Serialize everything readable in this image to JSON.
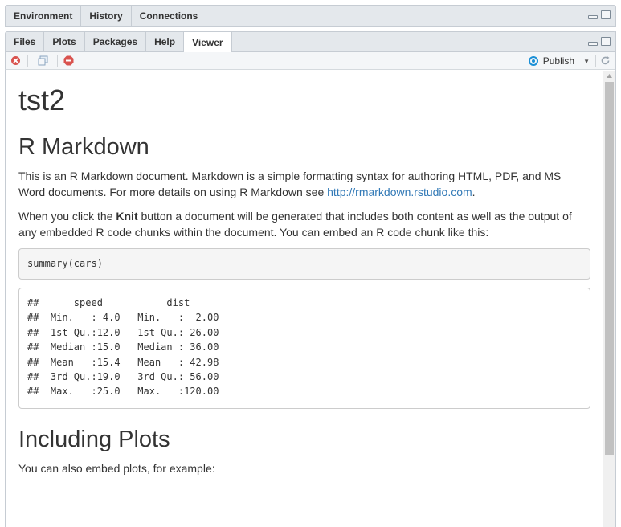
{
  "top_tabs": [
    {
      "label": "Environment"
    },
    {
      "label": "History"
    },
    {
      "label": "Connections"
    }
  ],
  "bottom_tabs": [
    {
      "label": "Files"
    },
    {
      "label": "Plots"
    },
    {
      "label": "Packages"
    },
    {
      "label": "Help"
    },
    {
      "label": "Viewer",
      "active": true
    }
  ],
  "toolbar": {
    "publish_label": "Publish",
    "icons": [
      "remove-viewer-icon",
      "show-in-new-window-icon",
      "stop-icon",
      "publish-icon",
      "refresh-icon"
    ]
  },
  "document": {
    "title": "tst2",
    "section1_heading": "R Markdown",
    "para1_text": "This is an R Markdown document. Markdown is a simple formatting syntax for authoring HTML, PDF, and MS Word documents. For more details on using R Markdown see ",
    "para1_link": "http://rmarkdown.rstudio.com",
    "para1_end": ".",
    "para2_before": "When you click the ",
    "para2_bold": "Knit",
    "para2_after": " button a document will be generated that includes both content as well as the output of any embedded R code chunks within the document. You can embed an R code chunk like this:",
    "code_chunk": "summary(cars)",
    "output_lines": [
      "##      speed           dist       ",
      "##  Min.   : 4.0   Min.   :  2.00  ",
      "##  1st Qu.:12.0   1st Qu.: 26.00  ",
      "##  Median :15.0   Median : 36.00  ",
      "##  Mean   :15.4   Mean   : 42.98  ",
      "##  3rd Qu.:19.0   3rd Qu.: 56.00  ",
      "##  Max.   :25.0   Max.   :120.00  "
    ],
    "section2_heading": "Including Plots",
    "para3_text": "You can also embed plots, for example:"
  },
  "colors": {
    "link": "#337ab7",
    "text": "#333333",
    "tab_bg": "#e4e8ec",
    "stop_red": "#d9534f",
    "publish_blue": "#1a8fd6"
  }
}
